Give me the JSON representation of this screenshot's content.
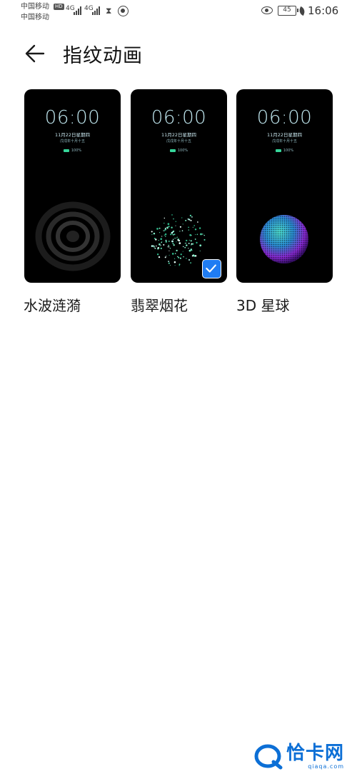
{
  "status_bar": {
    "carrier_1": "中国移动",
    "carrier_2": "中国移动",
    "hd": "HD",
    "network_1": "4G",
    "network_2": "4G",
    "battery_level": "45",
    "time": "16:06"
  },
  "header": {
    "title": "指纹动画"
  },
  "animations": [
    {
      "label": "水波涟漪",
      "preview_time": "06:00",
      "preview_date": "11月22日星期四",
      "preview_lunar": "戊戌年十月十五",
      "preview_battery": "100%",
      "selected": false
    },
    {
      "label": "翡翠烟花",
      "preview_time": "06:00",
      "preview_date": "11月22日星期四",
      "preview_lunar": "戊戌年十月十五",
      "preview_battery": "100%",
      "selected": true
    },
    {
      "label": "3D 星球",
      "preview_time": "06:00",
      "preview_date": "11月22日星期四",
      "preview_lunar": "戊戌年十月十五",
      "preview_battery": "100%",
      "selected": false
    }
  ],
  "watermark": {
    "brand": "恰卡网",
    "domain": "qiaqa.com"
  },
  "colors": {
    "accent_blue": "#1f7cf3",
    "preview_bg": "#000000",
    "preview_text": "#bfe6ee"
  },
  "icons": [
    "back-arrow-icon",
    "checkmark-icon",
    "eye-icon",
    "battery-icon",
    "hourglass-icon",
    "nfc-icon",
    "leaf-icon",
    "signal-icon"
  ]
}
